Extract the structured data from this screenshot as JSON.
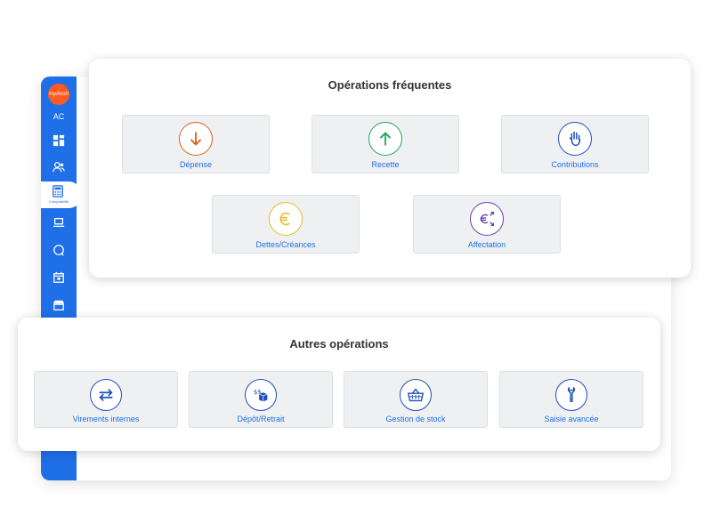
{
  "sidebar": {
    "logo_text": "myAcon",
    "user_initials": "AC",
    "active_item_label": "Comptabilité",
    "accent_color": "#1e6fe8",
    "logo_color": "#ff5a1f",
    "icons": [
      "dashboard-icon",
      "users-icon",
      "calculator-icon",
      "laptop-icon",
      "chat-icon",
      "calendar-icon",
      "shop-icon"
    ]
  },
  "frequent": {
    "title": "Opérations fréquentes",
    "tiles": [
      {
        "label": "Dépense",
        "icon": "arrow-down-icon",
        "color": "#d9621f"
      },
      {
        "label": "Recette",
        "icon": "arrow-up-icon",
        "color": "#1fa657"
      },
      {
        "label": "Contributions",
        "icon": "hand-icon",
        "color": "#1e4fb8"
      },
      {
        "label": "Dettes/Créances",
        "icon": "euro-icon",
        "color": "#e8b82b"
      },
      {
        "label": "Affectation",
        "icon": "euro-exchange-icon",
        "color": "#6a3ea8"
      }
    ]
  },
  "other": {
    "title": "Autres opérations",
    "tiles": [
      {
        "label": "Virements internes",
        "icon": "transfer-arrows-icon",
        "color": "#1e4fb8"
      },
      {
        "label": "Dépôt/Retrait",
        "icon": "money-box-icon",
        "color": "#1e4fb8"
      },
      {
        "label": "Gestion de stock",
        "icon": "basket-icon",
        "color": "#1e4fb8"
      },
      {
        "label": "Saisie avancée",
        "icon": "wrench-icon",
        "color": "#1e4fb8"
      }
    ]
  }
}
